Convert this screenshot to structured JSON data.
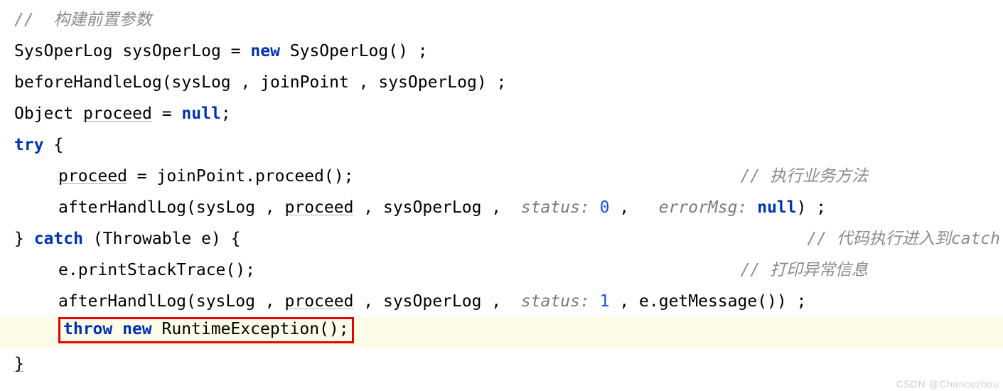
{
  "code": {
    "comment_build": "//  构建前置参数",
    "line2": {
      "type1": "SysOperLog",
      "var": "sysOperLog",
      "eq": " = ",
      "new": "new",
      "type2": " SysOperLog() ;"
    },
    "line3": "beforeHandleLog(sysLog , joinPoint , sysOperLog) ;",
    "line4": {
      "type": "Object ",
      "var": "proceed",
      "rest": " = ",
      "null": "null",
      "semi": ";"
    },
    "try": "try",
    "brace_open": " {",
    "line6": {
      "var": "proceed",
      "rest": " = joinPoint.proceed();",
      "comment": "// 执行业务方法"
    },
    "line7": {
      "a": "afterHandlLog(sysLog , ",
      "proceed": "proceed",
      "b": " , sysOperLog ,  ",
      "hint_status": "status: ",
      "status_val": "0",
      "c": " ,   ",
      "hint_err": "errorMsg: ",
      "null": "null",
      "d": ") ;"
    },
    "line8": {
      "close": "} ",
      "catch": "catch",
      "decl": " (Throwable e) {",
      "comment": "// 代码执行进入到catch"
    },
    "line9": {
      "text": "e.printStackTrace();",
      "comment": "// 打印异常信息"
    },
    "line10": {
      "a": "afterHandlLog(sysLog , ",
      "proceed": "proceed",
      "b": " , sysOperLog ,  ",
      "hint_status": "status: ",
      "status_val": "1",
      "c": " , e.getMessage()) ;"
    },
    "line11": {
      "throw": "throw",
      "sp": " ",
      "new": "new",
      "rest": " RuntimeException();"
    },
    "close": "}"
  },
  "watermark": "CSDN @Chancezhou"
}
